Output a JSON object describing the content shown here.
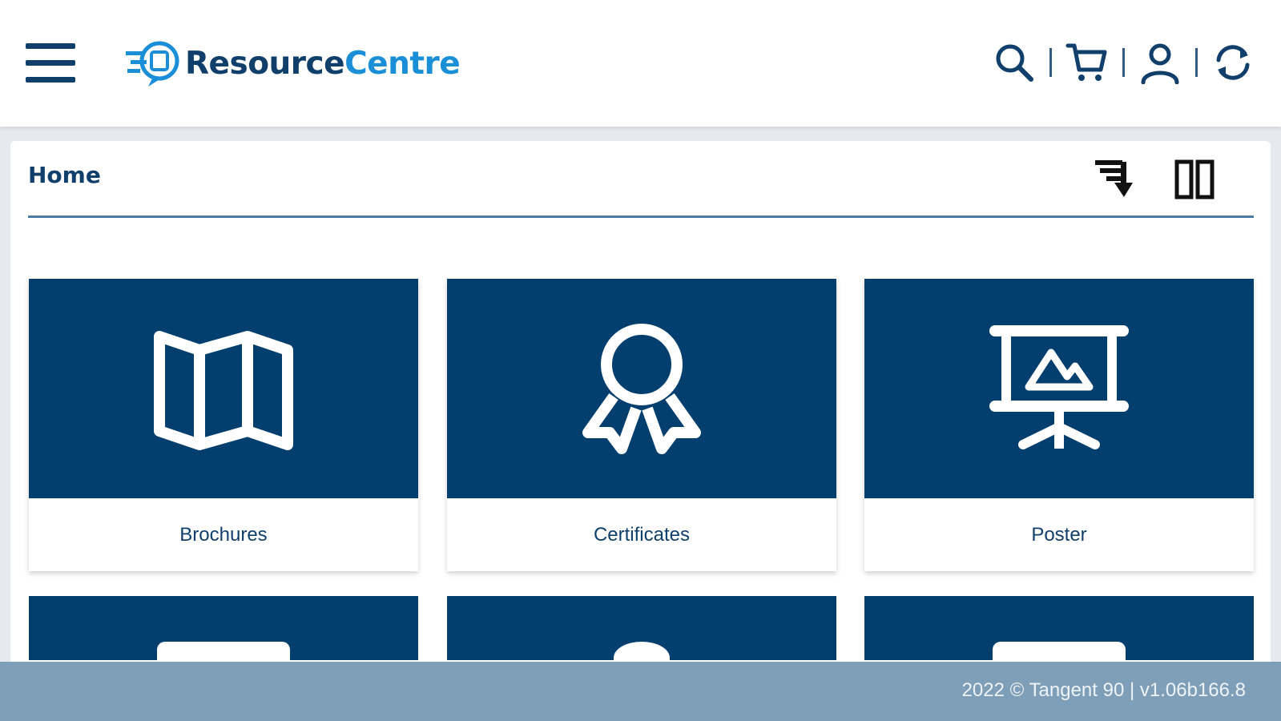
{
  "header": {
    "logo": {
      "part1": "Resource",
      "part2": "Centre"
    },
    "icons": [
      "menu-icon",
      "search-icon",
      "cart-icon",
      "user-icon",
      "refresh-icon"
    ]
  },
  "breadcrumb": {
    "label": "Home"
  },
  "toolbar": {
    "icons": [
      "sort-down-icon",
      "grid-view-icon"
    ]
  },
  "categories": [
    {
      "label": "Brochures",
      "icon": "map-icon"
    },
    {
      "label": "Certificates",
      "icon": "award-ribbon-icon"
    },
    {
      "label": "Poster",
      "icon": "presentation-board-icon"
    }
  ],
  "footer": {
    "text": "2022 © Tangent 90 | v1.06b166.8"
  },
  "colors": {
    "primary": "#023e6e",
    "accent": "#1a8fd8",
    "footer": "#7f9fb8",
    "text": "#103f6b"
  }
}
